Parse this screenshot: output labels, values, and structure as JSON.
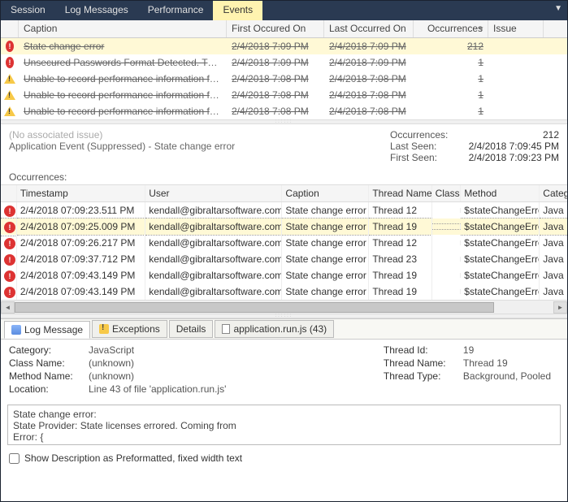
{
  "topTabs": {
    "t0": "Session",
    "t1": "Log Messages",
    "t2": "Performance",
    "t3": "Events"
  },
  "grid": {
    "headers": {
      "caption": "Caption",
      "first": "First Occured On",
      "last": "Last Occurred On",
      "occ": "Occurrences",
      "issue": "Issue"
    },
    "rows": [
      {
        "icon": "err",
        "caption": "State change error",
        "first": "2/4/2018 7:09 PM",
        "last": "2/4/2018 7:09 PM",
        "occ": "212",
        "sel": true
      },
      {
        "icon": "err",
        "caption": "Unsecured Passwords Format Detected. The …",
        "first": "2/4/2018 7:09 PM",
        "last": "2/4/2018 7:09 PM",
        "occ": "1"
      },
      {
        "icon": "warn",
        "caption": "Unable to record performance information for …",
        "first": "2/4/2018 7:08 PM",
        "last": "2/4/2018 7:08 PM",
        "occ": "1"
      },
      {
        "icon": "warn",
        "caption": "Unable to record performance information for …",
        "first": "2/4/2018 7:08 PM",
        "last": "2/4/2018 7:08 PM",
        "occ": "1"
      },
      {
        "icon": "warn",
        "caption": "Unable to record performance information for …",
        "first": "2/4/2018 7:08 PM",
        "last": "2/4/2018 7:08 PM",
        "occ": "1"
      }
    ]
  },
  "mid": {
    "noIssue": "(No associated issue)",
    "title": "Application Event (Suppressed) - State change error",
    "kv": {
      "occLabel": "Occurrences:",
      "occVal": "212",
      "lastLabel": "Last Seen:",
      "lastVal": "2/4/2018 7:09:45 PM",
      "firstLabel": "First Seen:",
      "firstVal": "2/4/2018 7:09:23 PM"
    },
    "occTitle": "Occurrences:"
  },
  "occ": {
    "headers": {
      "ts": "Timestamp",
      "user": "User",
      "caption": "Caption",
      "thread": "Thread Name",
      "class": "Class",
      "method": "Method",
      "cat": "Categor"
    },
    "rows": [
      {
        "ts": "2/4/2018 07:09:23.511 PM",
        "user": "kendall@gibraltarsoftware.com",
        "caption": "State change error",
        "thread": "Thread 12",
        "method": "$stateChangeError",
        "cat": "Java"
      },
      {
        "ts": "2/4/2018 07:09:25.009 PM",
        "user": "kendall@gibraltarsoftware.com",
        "caption": "State change error",
        "thread": "Thread 19",
        "method": "$stateChangeError",
        "cat": "Java",
        "sel": true
      },
      {
        "ts": "2/4/2018 07:09:26.217 PM",
        "user": "kendall@gibraltarsoftware.com",
        "caption": "State change error",
        "thread": "Thread 12",
        "method": "$stateChangeError",
        "cat": "Java"
      },
      {
        "ts": "2/4/2018 07:09:37.712 PM",
        "user": "kendall@gibraltarsoftware.com",
        "caption": "State change error",
        "thread": "Thread 23",
        "method": "$stateChangeError",
        "cat": "Java"
      },
      {
        "ts": "2/4/2018 07:09:43.149 PM",
        "user": "kendall@gibraltarsoftware.com",
        "caption": "State change error",
        "thread": "Thread 19",
        "method": "$stateChangeError",
        "cat": "Java"
      },
      {
        "ts": "2/4/2018 07:09:43.149 PM",
        "user": "kendall@gibraltarsoftware.com",
        "caption": "State change error",
        "thread": "Thread 19",
        "method": "$stateChangeError",
        "cat": "Java"
      }
    ]
  },
  "btabs": {
    "t0": "Log Message",
    "t1": "Exceptions",
    "t2": "Details",
    "t3": "application.run.js (43)"
  },
  "details": {
    "left": {
      "catK": "Category:",
      "catV": "JavaScript",
      "clsK": "Class Name:",
      "clsV": "(unknown)",
      "mthK": "Method Name:",
      "mthV": "(unknown)",
      "locK": "Location:",
      "locV": "Line 43 of file 'application.run.js'"
    },
    "right": {
      "tidK": "Thread Id:",
      "tidV": "19",
      "tnmK": "Thread Name:",
      "tnmV": "Thread 19",
      "ttpK": "Thread Type:",
      "ttpV": "Background, Pooled"
    }
  },
  "desc": {
    "l1": "State change error:",
    "l2": "State Provider: State licenses errored. Coming from",
    "l3": "Error: {"
  },
  "checkLabel": "Show Description as Preformatted, fixed width text"
}
